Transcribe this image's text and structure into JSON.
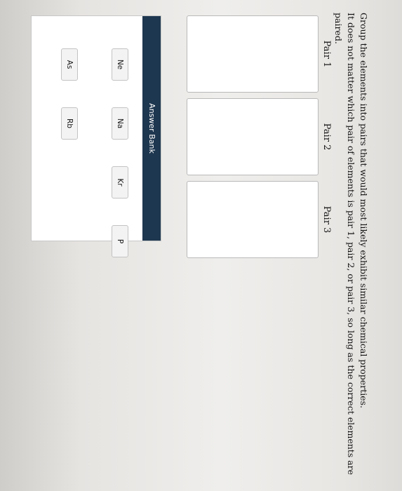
{
  "question": {
    "line1": "Group the elements into pairs that would most likely exhibit similar chemical properties.",
    "line2": "It does not matter which pair of elements is pair 1, pair 2, or pair 3, so long as the correct elements are paired."
  },
  "pairs": [
    {
      "label": "Pair 1"
    },
    {
      "label": "Pair 2"
    },
    {
      "label": "Pair 3"
    }
  ],
  "answer_bank": {
    "title": "Answer Bank",
    "items": [
      "Ne",
      "Na",
      "Kr",
      "P",
      "As",
      "Rb"
    ]
  }
}
